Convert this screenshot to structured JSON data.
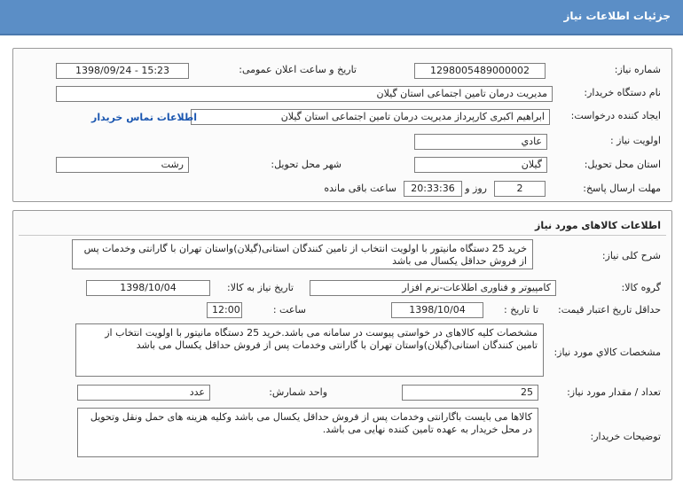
{
  "header": {
    "title": "جزئیات اطلاعات نیاز"
  },
  "need_info": {
    "need_number_label": "شماره نیاز:",
    "need_number": "1298005489000002",
    "announce_label": "تاریخ و ساعت اعلان عمومی:",
    "announce_value": "1398/09/24 - 15:23",
    "buyer_label": "نام دستگاه خریدار:",
    "buyer_value": "مدیریت درمان تامین اجتماعی استان گیلان",
    "creator_label": "ایجاد کننده درخواست:",
    "creator_value": "ابراهیم اکبری کارپرداز مدیریت درمان تامین اجتماعی استان گیلان",
    "contact_link": "اطلاعات تماس خریدار",
    "priority_label": "اولویت نیاز :",
    "priority_value": "عادي",
    "province_label": "استان محل تحویل:",
    "province_value": "گیلان",
    "city_label": "شهر محل تحویل:",
    "city_value": "رشت",
    "deadline_label": "مهلت ارسال پاسخ:",
    "deadline_days": "2",
    "days_label": "روز و",
    "deadline_time": "20:33:36",
    "remaining_label": "ساعت باقی مانده"
  },
  "goods": {
    "section_title": "اطلاعات کالاهای مورد نیاز",
    "summary_label": "شرح کلی نیاز:",
    "summary_value": "خرید 25 دستگاه مانیتور با اولویت انتخاب از تامین کنندگان استانی(گیلان)واستان تهران با گارانتی وخدمات پس از فروش حداقل یکسال می باشد",
    "group_label": "گروه کالا:",
    "group_value": "کامپیوتر و فناوری اطلاعات-نرم افزار",
    "need_date_label": "تاریخ نیاز به کالا:",
    "need_date_value": "1398/10/04",
    "min_validity_label": "حداقل تاریخ اعتبار قیمت:",
    "until_date_label": "تا تاریخ :",
    "until_date_value": "1398/10/04",
    "hour_label": "ساعت :",
    "hour_value": "12:00",
    "specs_label": "مشخصات کالاي مورد نیاز:",
    "specs_value": "مشخصات کلیه کالاهای در خواستی پیوست در سامانه می باشد.خرید 25 دستگاه مانیتور با اولویت انتخاب از تامین کنندگان استانی(گیلان)واستان تهران با گارانتی وخدمات پس از فروش حداقل یکسال می باشد",
    "qty_label": "تعداد / مقدار مورد نیاز:",
    "qty_value": "25",
    "unit_label": "واحد شمارش:",
    "unit_value": "عدد",
    "buyer_notes_label": "توضیحات خریدار:",
    "buyer_notes_value": "کالاها می بایست باگارانتی وخدمات پس از فروش حداقل یکسال می باشد وکلیه هزینه های حمل ونقل وتحویل در محل خریدار به عهده تامین کننده نهایی می باشد."
  },
  "colors": {
    "header": "#5b8ec6",
    "link": "#1a56b0",
    "watermark": "#e4e4e4"
  }
}
